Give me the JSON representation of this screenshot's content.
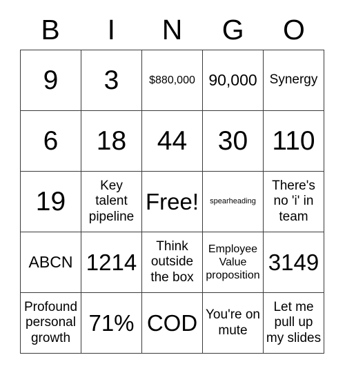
{
  "card": {
    "headers": [
      "B",
      "I",
      "N",
      "G",
      "O"
    ],
    "rows": [
      [
        {
          "text": "9",
          "size": "xl"
        },
        {
          "text": "3",
          "size": "xl"
        },
        {
          "text": "$880,000",
          "size": "xs"
        },
        {
          "text": "90,000",
          "size": "md"
        },
        {
          "text": "Synergy",
          "size": "sm"
        }
      ],
      [
        {
          "text": "6",
          "size": "xl"
        },
        {
          "text": "18",
          "size": "xl"
        },
        {
          "text": "44",
          "size": "xl"
        },
        {
          "text": "30",
          "size": "xl"
        },
        {
          "text": "110",
          "size": "xl"
        }
      ],
      [
        {
          "text": "19",
          "size": "xl"
        },
        {
          "text": "Key talent pipeline",
          "size": "sm"
        },
        {
          "text": "Free!",
          "size": "lg"
        },
        {
          "text": "spearheading",
          "size": "xxs"
        },
        {
          "text": "There's no 'i' in team",
          "size": "sm"
        }
      ],
      [
        {
          "text": "ABCN",
          "size": "md"
        },
        {
          "text": "1214",
          "size": "lg"
        },
        {
          "text": "Think outside the box",
          "size": "sm"
        },
        {
          "text": "Employee Value proposition",
          "size": "xs"
        },
        {
          "text": "3149",
          "size": "lg"
        }
      ],
      [
        {
          "text": "Profound personal growth",
          "size": "sm"
        },
        {
          "text": "71%",
          "size": "lg"
        },
        {
          "text": "COD",
          "size": "lg"
        },
        {
          "text": "You're on mute",
          "size": "sm"
        },
        {
          "text": "Let me pull up my slides",
          "size": "sm"
        }
      ]
    ]
  }
}
